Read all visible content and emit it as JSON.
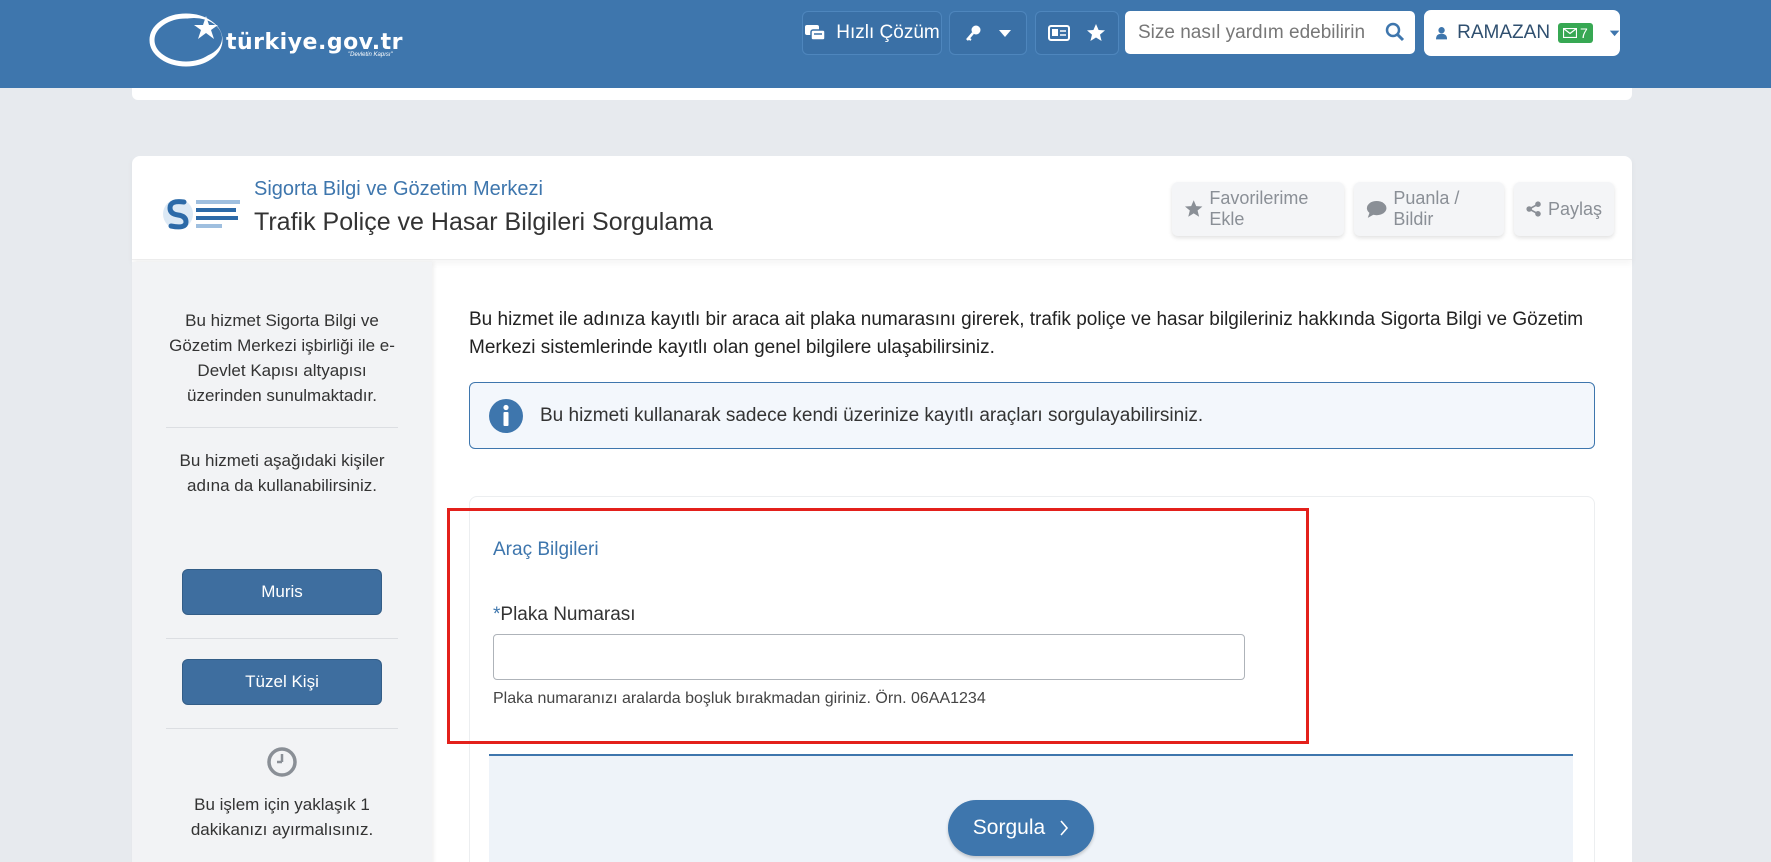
{
  "header": {
    "logo_text": "türkiye.gov.tr",
    "logo_subtext": "\"Devletin Kapısı\"",
    "quick_solution_label": "Hızlı Çözüm",
    "search_placeholder": "Size nasıl yardım edebilirin",
    "user_name": "RAMAZAN",
    "message_count": "7"
  },
  "service": {
    "organization": "Sigorta Bilgi ve Gözetim Merkezi",
    "title": "Trafik Poliçe ve Hasar Bilgileri Sorgulama",
    "actions": {
      "favorite": "Favorilerime Ekle",
      "rate": "Puanla / Bildir",
      "share": "Paylaş"
    }
  },
  "sidebar": {
    "provided_by": "Bu hizmet Sigorta Bilgi ve Gözetim Merkezi işbirliği ile e-Devlet Kapısı altyapısı üzerinden sunulmaktadır.",
    "on_behalf": "Bu hizmeti aşağıdaki kişiler adına da kullanabilirsiniz.",
    "buttons": [
      "Muris",
      "Tüzel Kişi"
    ],
    "duration": "Bu işlem için yaklaşık 1 dakikanızı ayırmalısınız."
  },
  "main": {
    "intro": "Bu hizmet ile adınıza kayıtlı bir araca ait plaka numarasını girerek, trafik poliçe ve hasar bilgileriniz hakkında Sigorta Bilgi ve Gözetim Merkezi sistemlerinde kayıtlı olan genel bilgilere ulaşabilirsiniz.",
    "info": "Bu hizmeti kullanarak sadece kendi üzerinize kayıtlı araçları sorgulayabilirsiniz.",
    "section_title": "Araç Bilgileri",
    "field_required_mark": "*",
    "field_label": "Plaka Numarası",
    "field_value": "",
    "field_hint": "Plaka numaranızı aralarda boşluk bırakmadan giriniz. Örn. 06AA1234",
    "submit_label": "Sorgula"
  },
  "colors": {
    "brand": "#3e76ad",
    "highlight": "#e3201b",
    "badge": "#37a853"
  }
}
